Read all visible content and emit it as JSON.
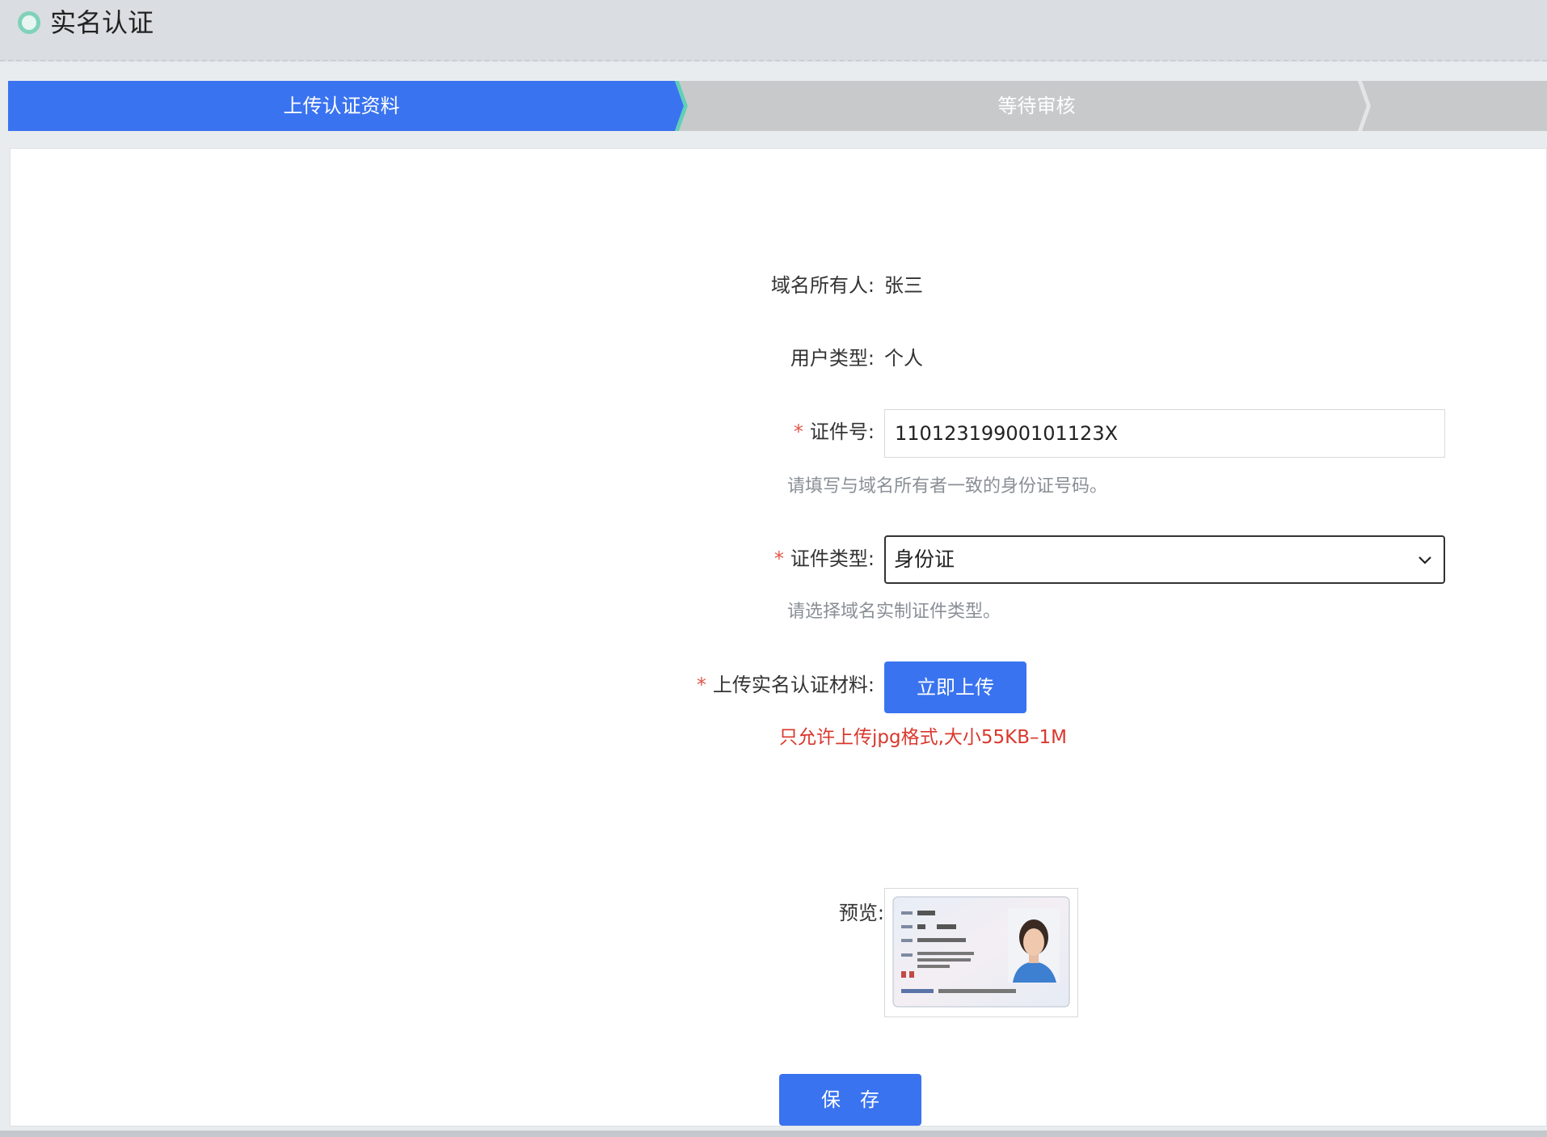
{
  "header": {
    "title": "实名认证"
  },
  "steps": [
    {
      "label": "上传认证资料",
      "active": true
    },
    {
      "label": "等待审核",
      "active": false
    }
  ],
  "colors": {
    "primary": "#3a73f0",
    "step_inactive": "#c8c9cb",
    "error": "#d9382d"
  },
  "form": {
    "owner": {
      "label": "域名所有人:",
      "value": "张三"
    },
    "user_type": {
      "label": "用户类型:",
      "value": "个人"
    },
    "id_number": {
      "required_mark": "*",
      "label": "证件号:",
      "value": "11012319900101123X",
      "hint": "请填写与域名所有者一致的身份证号码。"
    },
    "id_type": {
      "required_mark": "*",
      "label": "证件类型:",
      "selected": "身份证",
      "hint": "请选择域名实制证件类型。"
    },
    "upload": {
      "required_mark": "*",
      "label": "上传实名认证材料:",
      "button": "立即上传",
      "hint": "只允许上传jpg格式,大小55KB–1M"
    },
    "preview": {
      "label": "预览:",
      "image": "id-card-preview"
    },
    "save_button": "保存"
  }
}
